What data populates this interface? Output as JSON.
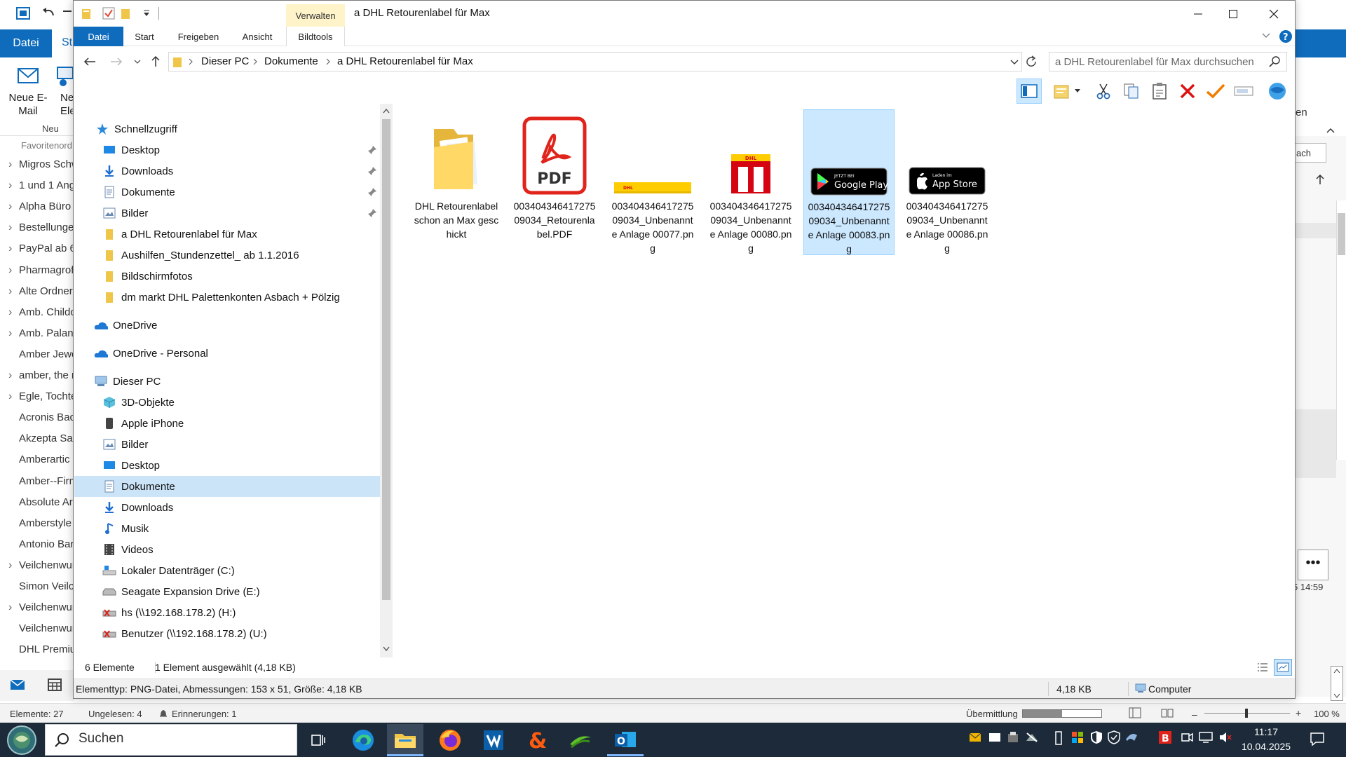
{
  "outlook": {
    "tabs": {
      "file": "Datei",
      "start": "St"
    },
    "ribbon": {
      "new_mail": "Neue E-Mail",
      "new_item": "Ne Eleme",
      "group_new": "Neu",
      "right_label": "en"
    },
    "favorites_label": "Favoritenord",
    "folders": [
      "Migros Schw",
      "1 und 1 Ang",
      "Alpha Büro",
      "Bestellunge",
      "PayPal ab 6.",
      "Pharmagrof",
      "Alte Ordner",
      "Amb. Childc",
      "Amb. Palang",
      "Amber Jewe",
      "amber, the n",
      "Egle, Tochte",
      "Acronis Bac",
      "Akzepta Sac",
      "Amberartic",
      "Amber--Firm",
      "Absolute Ar",
      "Amberstyle",
      "Antonio Bar",
      "Veilchenwur",
      "Simon Veilc",
      "Veilchenwur",
      "Veilchenwur",
      "DHL Premiu"
    ],
    "right_pane": {
      "dropdown": "ach",
      "timestamp": "5 14:59"
    },
    "status": {
      "elements": "Elemente: 27",
      "unread": "Ungelesen: 4",
      "reminders": "Erinnerungen: 1",
      "transfer": "Übermittlung",
      "zoom": "100 %"
    }
  },
  "explorer": {
    "manage_tab": "Verwalten",
    "title": "a DHL Retourenlabel für Max",
    "tabs": [
      "Datei",
      "Start",
      "Freigeben",
      "Ansicht",
      "Bildtools"
    ],
    "breadcrumb": [
      "Dieser PC",
      "Dokumente",
      "a DHL Retourenlabel für Max"
    ],
    "search_placeholder": "a DHL Retourenlabel für Max durchsuchen",
    "nav": {
      "quick_access": "Schnellzugriff",
      "quick_items": [
        "Desktop",
        "Downloads",
        "Dokumente",
        "Bilder",
        "a DHL Retourenlabel für Max",
        "Aushilfen_Stundenzettel_ ab 1.1.2016",
        "Bildschirmfotos",
        "dm markt  DHL Palettenkonten Asbach + Pölzig"
      ],
      "onedrive": "OneDrive",
      "onedrive_personal": "OneDrive - Personal",
      "this_pc": "Dieser PC",
      "pc_items": [
        "3D-Objekte",
        "Apple iPhone",
        "Bilder",
        "Desktop",
        "Dokumente",
        "Downloads",
        "Musik",
        "Videos",
        "Lokaler Datenträger (C:)",
        "Seagate Expansion Drive (E:)",
        "hs (\\\\192.168.178.2) (H:)",
        "Benutzer (\\\\192.168.178.2) (U:)"
      ]
    },
    "files": [
      {
        "name": "DHL Retourenlabel schon an Max geschickt",
        "type": "folder"
      },
      {
        "name": "00340434641727509034_Retourenlabel.PDF",
        "type": "pdf",
        "icon_text": "PDF"
      },
      {
        "name": "00340434641727509034_Unbenannte Anlage 00077.png",
        "type": "dhl-banner",
        "icon_text": "DHL"
      },
      {
        "name": "00340434641727509034_Unbenannte Anlage 00080.png",
        "type": "dhl-box",
        "icon_text": "DHL"
      },
      {
        "name": "00340434641727509034_Unbenannte Anlage 00083.png",
        "type": "google-play",
        "icon_small": "JETZT BEI",
        "icon_text": "Google Play"
      },
      {
        "name": "00340434641727509034_Unbenannte Anlage 00086.png",
        "type": "app-store",
        "icon_small": "Laden im",
        "icon_text": "App Store"
      }
    ],
    "status": {
      "count": "6 Elemente",
      "selected": "1 Element ausgewählt (4,18 KB)"
    },
    "details": {
      "info": "Elementtyp: PNG-Datei, Abmessungen: 153 x 51, Größe: 4,18 KB",
      "size": "4,18 KB",
      "location": "Computer"
    }
  },
  "taskbar": {
    "search": "Suchen",
    "time": "11:17",
    "date": "10.04.2025"
  },
  "colors": {
    "accent": "#0f6cbd",
    "selection": "#cce8ff",
    "taskbar": "#1c2a3a",
    "manage": "#fff4c9"
  }
}
